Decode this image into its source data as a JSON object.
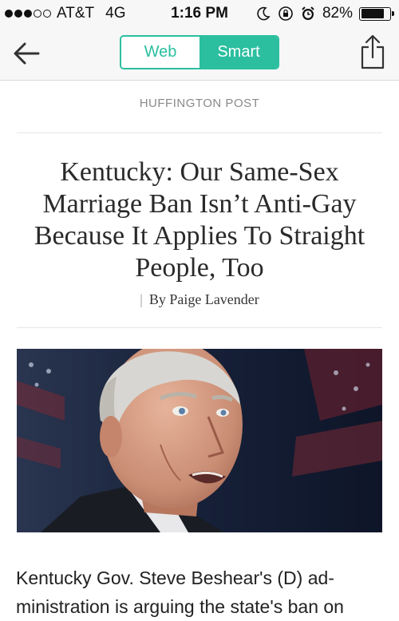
{
  "status_bar": {
    "carrier": "AT&T",
    "network": "4G",
    "time": "1:16 PM",
    "battery": "82%",
    "battery_level": 0.82,
    "signal_bars": 3,
    "icons": [
      "moon-icon",
      "rotation-lock-icon",
      "alarm-icon",
      "battery-icon"
    ]
  },
  "nav": {
    "back_icon": "back-arrow-icon",
    "tabs": [
      {
        "label": "Web",
        "selected": false
      },
      {
        "label": "Smart",
        "selected": true
      }
    ],
    "share_icon": "share-icon",
    "accent_color": "#2bbf9f"
  },
  "article": {
    "source": "HUFFINGTON POST",
    "headline_lines": [
      "Kentucky: Our Same-Sex",
      "Marriage Ban Isn’t Anti-Gay",
      "Because It Applies To Straight",
      "People, Too"
    ],
    "byline": "By Paige Lavender",
    "body_lines": [
      "Kentucky Gov. Steve Beshear's (D) ad-",
      "ministration is arguing the state's ban on"
    ]
  }
}
